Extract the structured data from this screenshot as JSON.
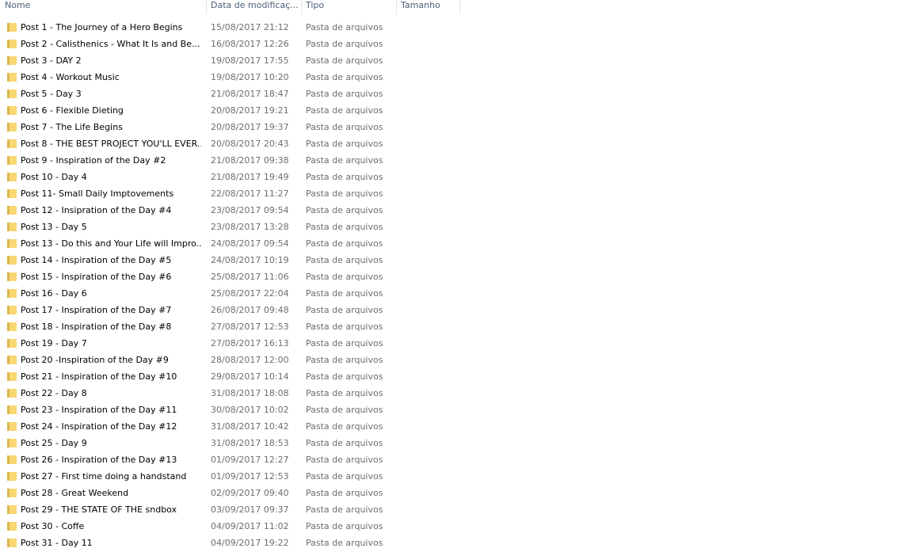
{
  "columns": {
    "name": "Nome",
    "date": "Data de modificaç...",
    "type": "Tipo",
    "size": "Tamanho"
  },
  "colors": {
    "header_text": "#4c607a",
    "meta_text": "#6d6d6d",
    "folder_fill": "#f8d775",
    "folder_dark": "#e0b64a"
  },
  "icons": {
    "folder": "folder-icon"
  },
  "files": [
    {
      "name": "Post 1 - The Journey of a Hero Begins",
      "date": "15/08/2017 21:12",
      "type": "Pasta de arquivos"
    },
    {
      "name": "Post 2 - Calisthenics  - What It Is and  Be...",
      "date": "16/08/2017 12:26",
      "type": "Pasta de arquivos"
    },
    {
      "name": "Post 3 - DAY 2",
      "date": "19/08/2017 17:55",
      "type": "Pasta de arquivos"
    },
    {
      "name": "Post 4 - Workout Music",
      "date": "19/08/2017 10:20",
      "type": "Pasta de arquivos"
    },
    {
      "name": "Post 5 - Day 3",
      "date": "21/08/2017 18:47",
      "type": "Pasta de arquivos"
    },
    {
      "name": "Post 6 - Flexible Dieting",
      "date": "20/08/2017 19:21",
      "type": "Pasta de arquivos"
    },
    {
      "name": "Post 7 - The Life Begins",
      "date": "20/08/2017 19:37",
      "type": "Pasta de arquivos"
    },
    {
      "name": "Post 8 - THE BEST PROJECT YOU'LL EVER...",
      "date": "20/08/2017 20:43",
      "type": "Pasta de arquivos"
    },
    {
      "name": "Post 9 - Inspiration of the Day #2",
      "date": "21/08/2017 09:38",
      "type": "Pasta de arquivos"
    },
    {
      "name": "Post 10 - Day 4",
      "date": "21/08/2017 19:49",
      "type": "Pasta de arquivos"
    },
    {
      "name": "Post 11- Small Daily Imptovements",
      "date": "22/08/2017 11:27",
      "type": "Pasta de arquivos"
    },
    {
      "name": "Post 12 - Insipration of the Day #4",
      "date": "23/08/2017 09:54",
      "type": "Pasta de arquivos"
    },
    {
      "name": "Post 13 - Day 5",
      "date": "23/08/2017 13:28",
      "type": "Pasta de arquivos"
    },
    {
      "name": "Post 13 - Do this and Your Life will Impro...",
      "date": "24/08/2017 09:54",
      "type": "Pasta de arquivos"
    },
    {
      "name": "Post 14 - Inspiration of the Day #5",
      "date": "24/08/2017 10:19",
      "type": "Pasta de arquivos"
    },
    {
      "name": "Post 15 - Inspiration of the Day #6",
      "date": "25/08/2017 11:06",
      "type": "Pasta de arquivos"
    },
    {
      "name": "Post 16 - Day 6",
      "date": "25/08/2017 22:04",
      "type": "Pasta de arquivos"
    },
    {
      "name": "Post 17 - Inspiration of the Day #7",
      "date": "26/08/2017 09:48",
      "type": "Pasta de arquivos"
    },
    {
      "name": "Post 18 - Inspiration of the Day #8",
      "date": "27/08/2017 12:53",
      "type": "Pasta de arquivos"
    },
    {
      "name": "Post 19 - Day 7",
      "date": "27/08/2017 16:13",
      "type": "Pasta de arquivos"
    },
    {
      "name": "Post 20 -Inspiration of the Day #9",
      "date": "28/08/2017 12:00",
      "type": "Pasta de arquivos"
    },
    {
      "name": "Post 21 - Inspiration of the Day #10",
      "date": "29/08/2017 10:14",
      "type": "Pasta de arquivos"
    },
    {
      "name": "Post 22 - Day 8",
      "date": "31/08/2017 18:08",
      "type": "Pasta de arquivos"
    },
    {
      "name": "Post 23 - Inspiration of the Day #11",
      "date": "30/08/2017 10:02",
      "type": "Pasta de arquivos"
    },
    {
      "name": "Post 24 - Inspiration of the Day #12",
      "date": "31/08/2017 10:42",
      "type": "Pasta de arquivos"
    },
    {
      "name": "Post 25 - Day 9",
      "date": "31/08/2017 18:53",
      "type": "Pasta de arquivos"
    },
    {
      "name": "Post 26 - Inspiration of the Day #13",
      "date": "01/09/2017 12:27",
      "type": "Pasta de arquivos"
    },
    {
      "name": "Post 27 - First time doing a handstand",
      "date": "01/09/2017 12:53",
      "type": "Pasta de arquivos"
    },
    {
      "name": "Post 28 - Great Weekend",
      "date": "02/09/2017 09:40",
      "type": "Pasta de arquivos"
    },
    {
      "name": "Post 29 - THE STATE OF THE sndbox",
      "date": "03/09/2017 09:37",
      "type": "Pasta de arquivos"
    },
    {
      "name": "Post 30 - Coffe",
      "date": "04/09/2017 11:02",
      "type": "Pasta de arquivos"
    },
    {
      "name": "Post 31 - Day 11",
      "date": "04/09/2017 19:22",
      "type": "Pasta de arquivos"
    }
  ]
}
